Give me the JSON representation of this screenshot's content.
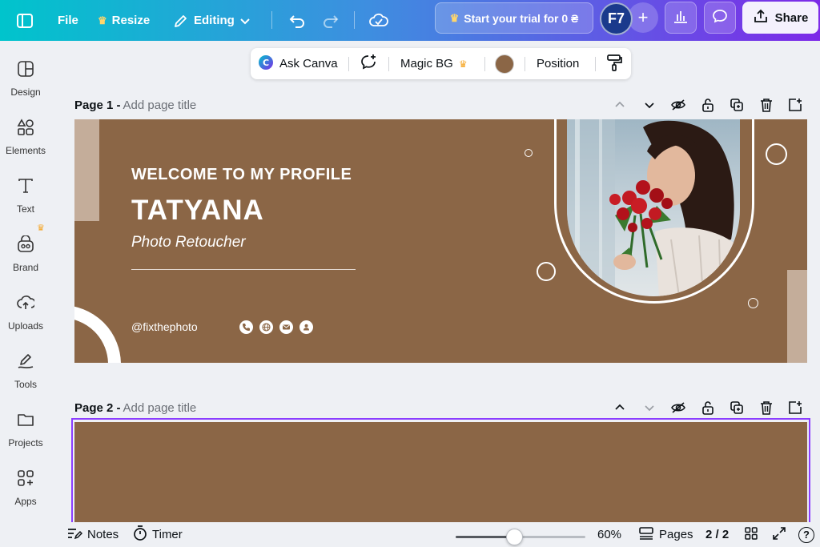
{
  "topbar": {
    "file_label": "File",
    "resize_label": "Resize",
    "editing_label": "Editing",
    "trial_label": "Start your trial for 0 ₴",
    "avatar_initials": "F7",
    "share_label": "Share"
  },
  "sidebar": {
    "items": [
      {
        "label": "Design"
      },
      {
        "label": "Elements"
      },
      {
        "label": "Text"
      },
      {
        "label": "Brand"
      },
      {
        "label": "Uploads"
      },
      {
        "label": "Tools"
      },
      {
        "label": "Projects"
      },
      {
        "label": "Apps"
      }
    ]
  },
  "context_toolbar": {
    "ask_canva_label": "Ask Canva",
    "magic_bg_label": "Magic BG",
    "color_swatch": "#8b6646",
    "position_label": "Position"
  },
  "pages": [
    {
      "name": "Page 1 -",
      "title_placeholder": "Add page title"
    },
    {
      "name": "Page 2 -",
      "title_placeholder": "Add page title"
    }
  ],
  "design": {
    "welcome": "WELCOME TO MY PROFILE",
    "name": "TATYANA",
    "role": "Photo Retoucher",
    "handle": "@fixthephoto",
    "background_color": "#8b6646",
    "accent_color": "#c4ad9a"
  },
  "bottombar": {
    "notes_label": "Notes",
    "timer_label": "Timer",
    "zoom_value": "60%",
    "zoom_fraction": 0.45,
    "pages_label": "Pages",
    "page_count": "2 / 2",
    "help_label": "?"
  },
  "colors": {
    "brand_gradient_start": "#00c4cc",
    "brand_gradient_end": "#7d2ae8",
    "selection": "#8b3dff"
  }
}
